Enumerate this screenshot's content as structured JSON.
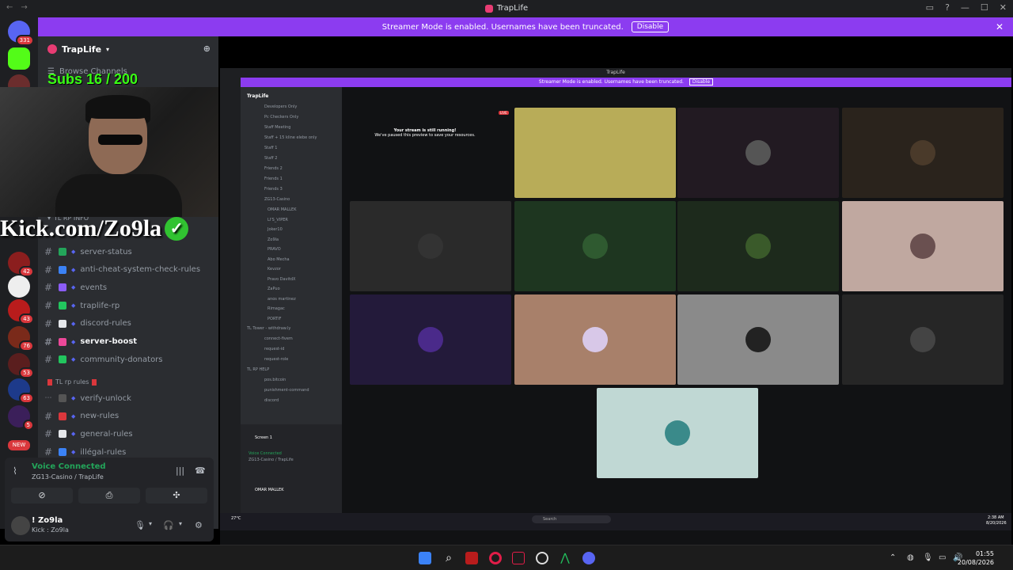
{
  "window": {
    "title": "TrapLife"
  },
  "banner": {
    "text": "Streamer Mode is enabled. Usernames have been truncated.",
    "button": "Disable"
  },
  "rail": {
    "badges": [
      {
        "label": "331"
      },
      {
        "label": "42"
      },
      {
        "label": "43"
      },
      {
        "label": "76"
      },
      {
        "label": "53"
      },
      {
        "label": "63"
      },
      {
        "label": "5"
      }
    ],
    "new_label": "NEW"
  },
  "server": {
    "name": "TrapLife",
    "browse": "Browse Channels"
  },
  "overlay": {
    "subs": "Subs 16 / 200",
    "kick": "Kick.com/Zo9la"
  },
  "categories": {
    "info": "TL RP INFO",
    "rules": "TL rp rules"
  },
  "channels": [
    {
      "name": "server-status",
      "color": "#23a55a",
      "bold": false
    },
    {
      "name": "anti-cheat-system-check-rules",
      "color": "#3b82f6",
      "bold": false
    },
    {
      "name": "events",
      "color": "#8b5cf6",
      "bold": false
    },
    {
      "name": "traplife-rp",
      "color": "#22c55e",
      "bold": false
    },
    {
      "name": "discord-rules",
      "color": "#e5e7eb",
      "bold": false
    },
    {
      "name": "server-boost",
      "color": "#ec4899",
      "bold": true
    },
    {
      "name": "community-donators",
      "color": "#22c55e",
      "bold": false
    }
  ],
  "rule_channels": [
    {
      "name": "verify-unlock",
      "color": "#555"
    },
    {
      "name": "new-rules",
      "color": "#da373c"
    },
    {
      "name": "general-rules",
      "color": "#e5e7eb"
    },
    {
      "name": "illégal-rules",
      "color": "#3b82f6"
    }
  ],
  "voice": {
    "status": "Voice Connected",
    "channel": "ZG13-Casino / TrapLife"
  },
  "user": {
    "name": "! Zo9la",
    "status": "Kick : Zo9la"
  },
  "capture": {
    "title": "TrapLife",
    "banner": "Streamer Mode is enabled. Usernames have been truncated.",
    "banner_btn": "Disable",
    "server": "TrapLife",
    "stream_title": "Your stream is still running!",
    "stream_sub": "We've paused this preview to save your resources.",
    "live": "LIVE",
    "channels": [
      "Developers Only",
      "Pc Checkers Only",
      "Staff Meeting",
      "Staff + 15 kline elebe only",
      "Staff 1",
      "Staff 2",
      "Friends 2",
      "Friends 1",
      "Friends 3",
      "ZG13-Casino"
    ],
    "members": [
      "OMAR MALLEK",
      "LI'S_VIPER",
      "Joker10",
      "Zo9la",
      "PRAVO",
      "Abo Mecha",
      "Kevzor",
      "Pravo DavitdX",
      "ZaPuo",
      "anos martinez",
      "Rimagac",
      "PORTIF"
    ],
    "cat2": "TL Tower - withdraw.ly",
    "lower": [
      "connect-fivem",
      "request-id",
      "request-role"
    ],
    "cat3": "TL RP HELP",
    "lower2": [
      "pos.bitcoin",
      "punishment-command",
      "discord"
    ],
    "screen": "Screen 1",
    "vc": "Voice Connected",
    "vc_sub": "ZG13-Casino / TrapLife",
    "user": "OMAR MALLEK",
    "search": "Search",
    "weather": "27°C",
    "time": "2:38 AM",
    "date": "8/20/2026"
  },
  "taskbar": {
    "time": "01:55",
    "date": "20/08/2026"
  }
}
